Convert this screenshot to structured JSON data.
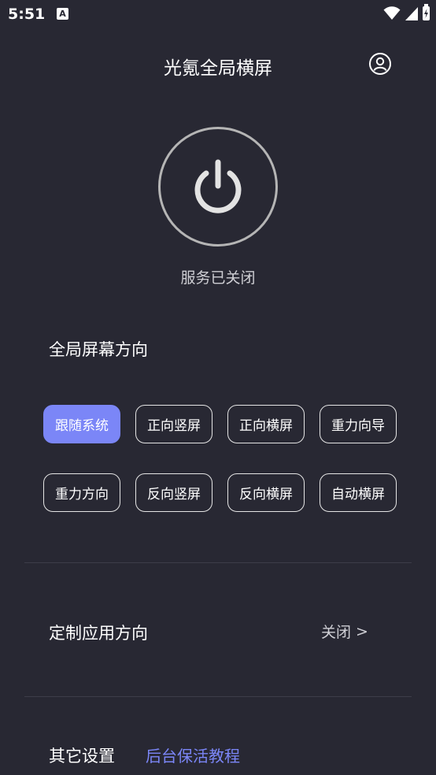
{
  "status_bar": {
    "time": "5:51",
    "notification_icon_letter": "A",
    "icons": [
      "wifi-icon",
      "signal-icon",
      "battery-charging-icon"
    ]
  },
  "header": {
    "title": "光氪全局横屏",
    "user_icon": "user-icon"
  },
  "power": {
    "icon": "power-icon",
    "status_text": "服务已关闭"
  },
  "global_orientation": {
    "title": "全局屏幕方向",
    "options": [
      {
        "label": "跟随系统",
        "selected": true
      },
      {
        "label": "正向竖屏",
        "selected": false
      },
      {
        "label": "正向横屏",
        "selected": false
      },
      {
        "label": "重力向导",
        "selected": false
      },
      {
        "label": "重力方向",
        "selected": false
      },
      {
        "label": "反向竖屏",
        "selected": false
      },
      {
        "label": "反向横屏",
        "selected": false
      },
      {
        "label": "自动横屏",
        "selected": false
      }
    ]
  },
  "custom_app_orientation": {
    "title": "定制应用方向",
    "value": "关闭",
    "arrow": ">"
  },
  "other_settings": {
    "title": "其它设置",
    "link": "后台保活教程"
  },
  "colors": {
    "background": "#282833",
    "accent": "#7b86f7",
    "ring": "#b5b5b5",
    "divider": "#3d3d49"
  }
}
